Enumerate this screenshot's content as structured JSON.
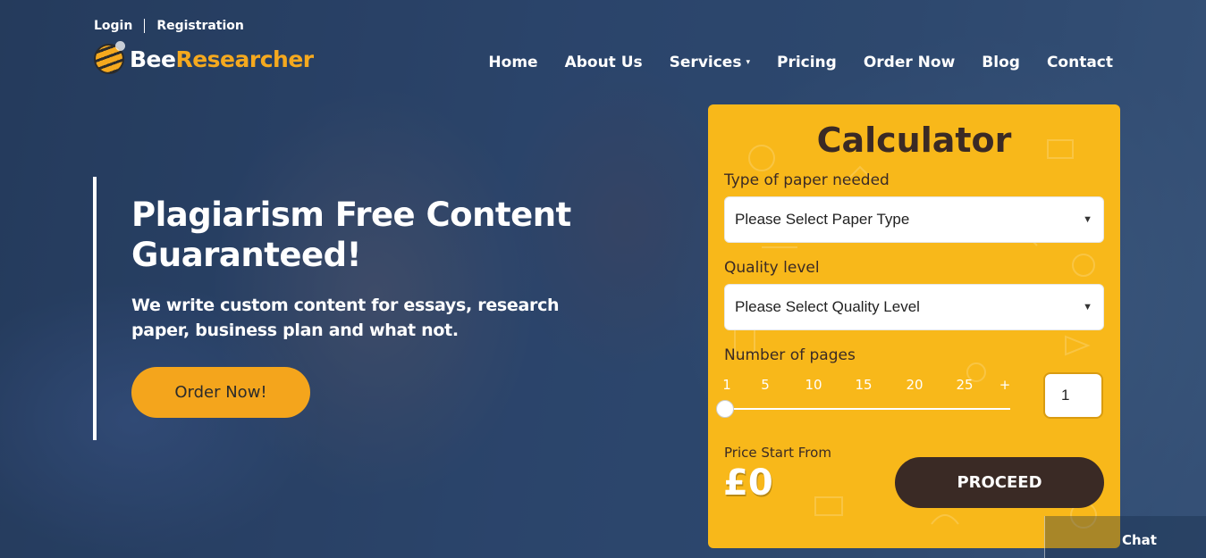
{
  "top_links": {
    "login": "Login",
    "registration": "Registration"
  },
  "logo": {
    "part1": "Bee",
    "part2": "Researcher",
    "icon": "bee-icon"
  },
  "nav": {
    "items": [
      "Home",
      "About Us",
      "Services",
      "Pricing",
      "Order Now",
      "Blog",
      "Contact"
    ],
    "services_caret": "▾"
  },
  "hero": {
    "title": "Plagiarism Free Content Guaranteed!",
    "subtitle": "We write custom content for essays, research paper, business plan and what not.",
    "order_button": "Order Now!"
  },
  "calculator": {
    "title": "Calculator",
    "paper_type_label": "Type of paper needed",
    "paper_type_value": "Please Select Paper Type",
    "quality_label": "Quality level",
    "quality_value": "Please Select Quality Level",
    "pages_label": "Number of pages",
    "slider_ticks": [
      "1",
      "5",
      "10",
      "15",
      "20",
      "25",
      "+"
    ],
    "slider_value": 1,
    "pages_value": "1",
    "price_label": "Price Start From",
    "price_value": "£0",
    "proceed_button": "PROCEED"
  },
  "chat": {
    "label": "Chat"
  },
  "colors": {
    "accent": "#f4a51c",
    "calculator_bg": "#f8b81a",
    "dark_brown": "#3a2a25",
    "hero_overlay": "#1c3458"
  }
}
